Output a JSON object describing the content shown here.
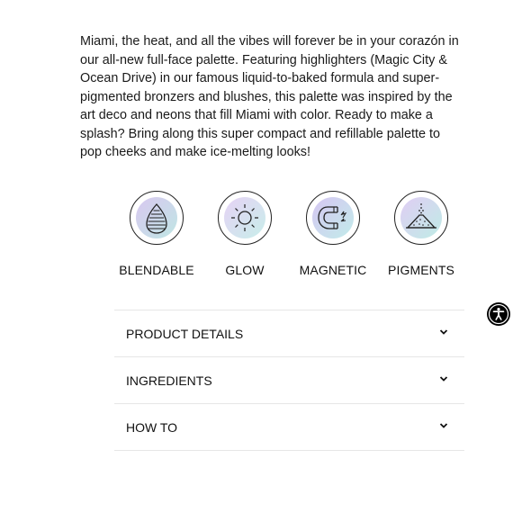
{
  "description": "Miami, the heat, and all the vibes will forever be in your corazón in our all-new full-face palette. Featuring highlighters (Magic City & Ocean Drive) in our famous liquid-to-baked formula and super-pigmented bronzers and blushes, this palette was inspired by the art deco and neons that fill Miami with color. Ready to make a splash? Bring along this super compact and refillable palette to pop cheeks and make ice-melting looks!",
  "features": [
    {
      "label": "BLENDABLE",
      "icon": "sponge-icon",
      "gradient": [
        "#d9c8f0",
        "#bfe6e4"
      ]
    },
    {
      "label": "GLOW",
      "icon": "sun-icon",
      "gradient": [
        "#e6d2f5",
        "#c8eeea"
      ]
    },
    {
      "label": "MAGNETIC",
      "icon": "magnet-icon",
      "gradient": [
        "#d6c6f2",
        "#c2ecea"
      ]
    },
    {
      "label": "PIGMENTS",
      "icon": "powder-pile-icon",
      "gradient": [
        "#e0cdf4",
        "#bfece6"
      ]
    }
  ],
  "accordion": [
    {
      "label": "PRODUCT DETAILS",
      "expanded": false
    },
    {
      "label": "INGREDIENTS",
      "expanded": false
    },
    {
      "label": "HOW TO",
      "expanded": false
    }
  ],
  "accessibility_button": {
    "icon": "accessibility-icon"
  }
}
